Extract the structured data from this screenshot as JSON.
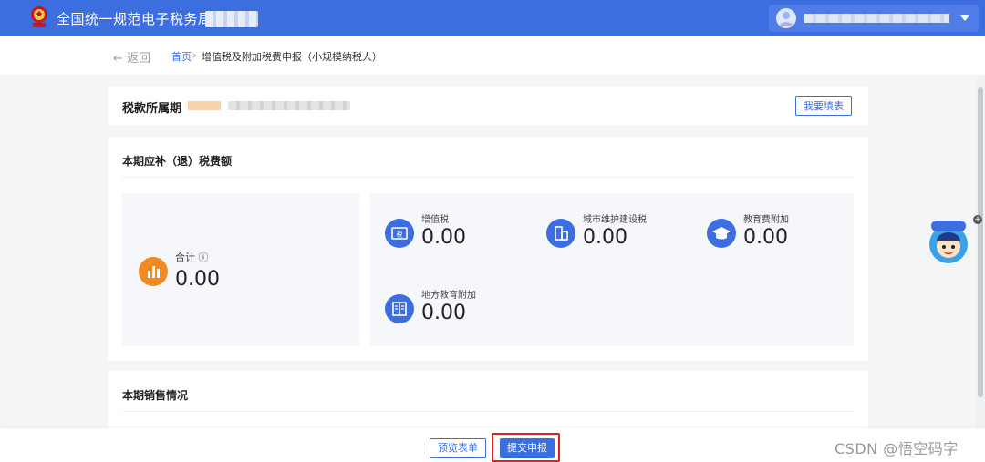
{
  "header": {
    "title": "全国统一规范电子税务局"
  },
  "breadcrumb": {
    "back": "返回",
    "home": "首页",
    "separator": "›",
    "current": "增值税及附加税费申报（小规模纳税人）"
  },
  "period": {
    "label": "税款所属期",
    "fill_button": "我要填表"
  },
  "tax_section": {
    "title": "本期应补（退）税费额",
    "total": {
      "label": "合计 ⓘ",
      "value": "0.00"
    },
    "items": [
      {
        "label": "增值税",
        "value": "0.00",
        "icon": "vat-icon"
      },
      {
        "label": "城市维护建设税",
        "value": "0.00",
        "icon": "building-icon"
      },
      {
        "label": "教育费附加",
        "value": "0.00",
        "icon": "graduation-cap-icon"
      },
      {
        "label": "地方教育附加",
        "value": "0.00",
        "icon": "ledger-icon"
      }
    ]
  },
  "sales_section": {
    "title": "本期销售情况"
  },
  "footer": {
    "preview_button": "预览表单",
    "submit_button": "提交申报"
  },
  "watermark": "CSDN @悟空码字",
  "colors": {
    "primary": "#3d6ee0",
    "total_icon": "#f08a24",
    "highlight": "#e02020"
  }
}
